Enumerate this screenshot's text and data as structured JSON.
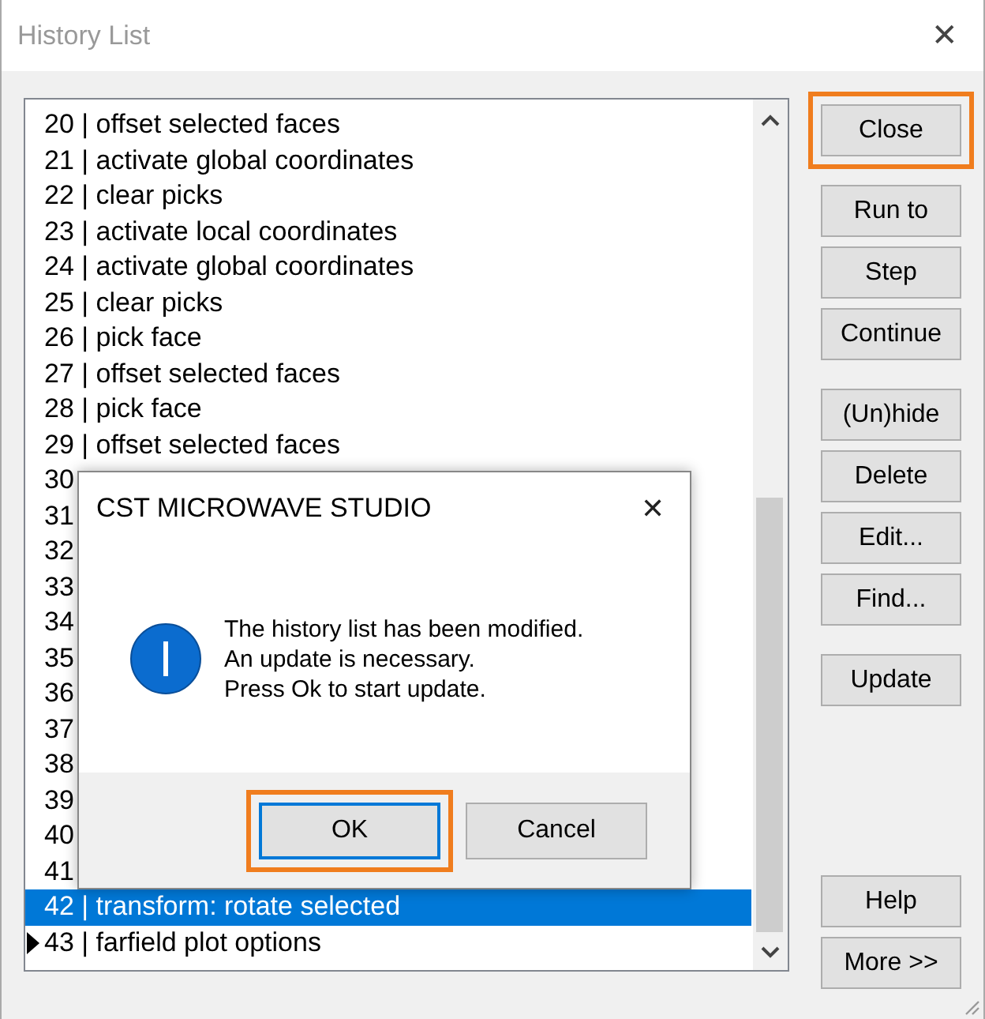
{
  "window": {
    "title": "History List",
    "close_glyph": "✕"
  },
  "history": [
    {
      "label": "20 | offset selected faces",
      "selected": false,
      "current": false
    },
    {
      "label": "21 | activate global coordinates",
      "selected": false,
      "current": false
    },
    {
      "label": "22 | clear picks",
      "selected": false,
      "current": false
    },
    {
      "label": "23 | activate local coordinates",
      "selected": false,
      "current": false
    },
    {
      "label": "24 | activate global coordinates",
      "selected": false,
      "current": false
    },
    {
      "label": "25 | clear picks",
      "selected": false,
      "current": false
    },
    {
      "label": "26 | pick face",
      "selected": false,
      "current": false
    },
    {
      "label": "27 | offset selected faces",
      "selected": false,
      "current": false
    },
    {
      "label": "28 | pick face",
      "selected": false,
      "current": false
    },
    {
      "label": "29 | offset selected faces",
      "selected": false,
      "current": false
    },
    {
      "label": "30",
      "selected": false,
      "current": false
    },
    {
      "label": "31",
      "selected": false,
      "current": false
    },
    {
      "label": "32",
      "selected": false,
      "current": false
    },
    {
      "label": "33",
      "selected": false,
      "current": false
    },
    {
      "label": "34",
      "selected": false,
      "current": false
    },
    {
      "label": "35",
      "selected": false,
      "current": false
    },
    {
      "label": "36",
      "selected": false,
      "current": false
    },
    {
      "label": "37",
      "selected": false,
      "current": false
    },
    {
      "label": "38",
      "selected": false,
      "current": false
    },
    {
      "label": "39",
      "selected": false,
      "current": false
    },
    {
      "label": "40",
      "selected": false,
      "current": false
    },
    {
      "label": "41",
      "selected": false,
      "current": false
    },
    {
      "label": "42 | transform: rotate selected",
      "selected": true,
      "current": false
    },
    {
      "label": "43 | farfield plot options",
      "selected": false,
      "current": true
    }
  ],
  "button_groups": [
    [
      {
        "label": "Close",
        "highlighted": true
      }
    ],
    [
      {
        "label": "Run to",
        "highlighted": false
      },
      {
        "label": "Step",
        "highlighted": false
      },
      {
        "label": "Continue",
        "highlighted": false
      }
    ],
    [
      {
        "label": "(Un)hide",
        "highlighted": false
      },
      {
        "label": "Delete",
        "highlighted": false
      },
      {
        "label": "Edit...",
        "highlighted": false
      },
      {
        "label": "Find...",
        "highlighted": false
      }
    ],
    [
      {
        "label": "Update",
        "highlighted": false
      }
    ],
    [
      {
        "label": "Help",
        "highlighted": false
      },
      {
        "label": "More >>",
        "highlighted": false
      }
    ]
  ],
  "dialog": {
    "title": "CST MICROWAVE STUDIO",
    "close_glyph": "✕",
    "message": [
      "The history list has been modified.",
      "An update is necessary.",
      "Press Ok to start update."
    ],
    "buttons": [
      {
        "label": "OK",
        "highlighted": true,
        "default": true
      },
      {
        "label": "Cancel",
        "highlighted": false,
        "default": false
      }
    ]
  }
}
